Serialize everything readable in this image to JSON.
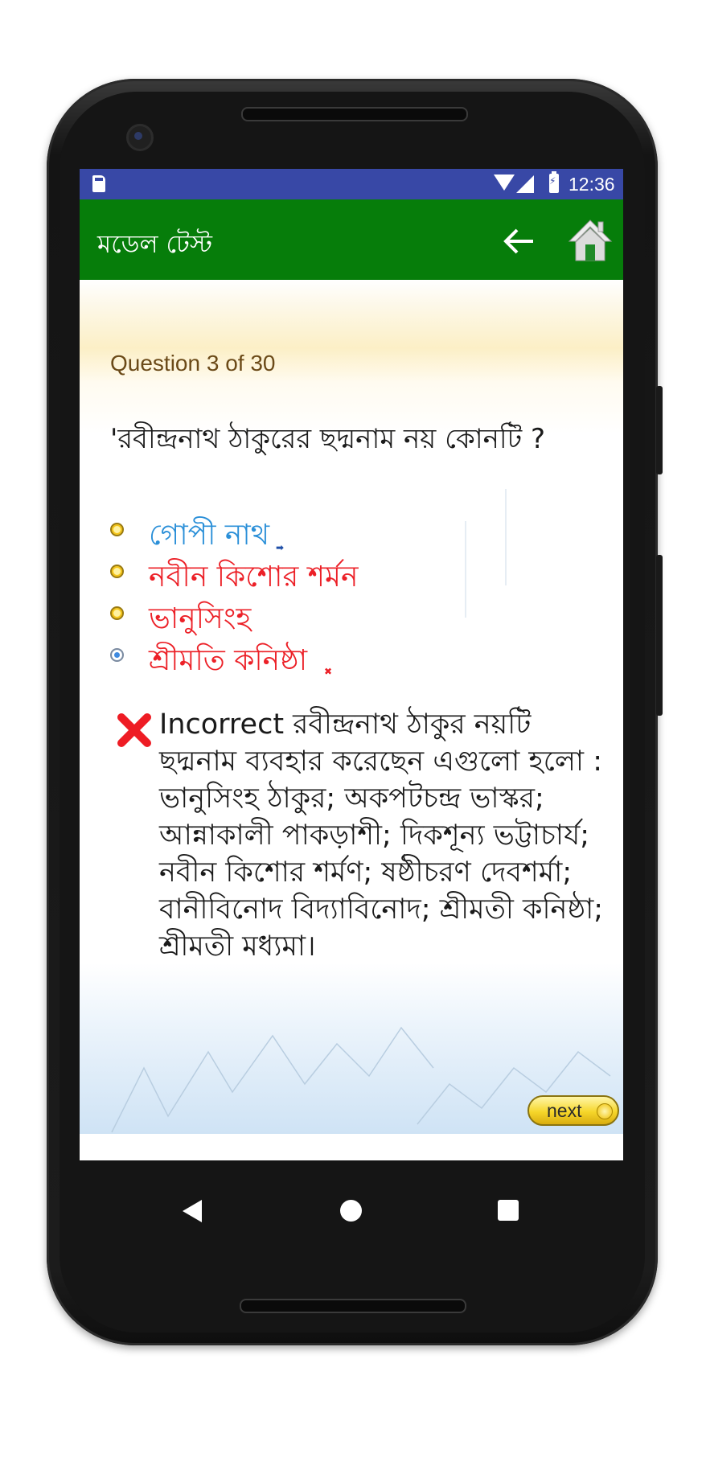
{
  "status_bar": {
    "time": "12:36"
  },
  "app_bar": {
    "title": "মডেল টেস্ট",
    "back_icon": "arrow-left-icon",
    "home_icon": "home-icon"
  },
  "quiz": {
    "counter": "Question 3 of 30",
    "question": "'রবীন্দ্রনাথ ঠাকুরের ছদ্মনাম নয় কোনটি ?",
    "options": [
      {
        "label": "গোপী নাথ",
        "color": "#2a8fd8",
        "selected": false,
        "marker": "correct-arrow"
      },
      {
        "label": "নবীন কিশোর শর্মন",
        "color": "#ec2027",
        "selected": false
      },
      {
        "label": "ভানুসিংহ",
        "color": "#ec2027",
        "selected": false
      },
      {
        "label": "শ্রীমতি কনিষ্ঠা",
        "color": "#ec2027",
        "selected": true,
        "marker": "wrong-x"
      }
    ],
    "feedback": {
      "status": "Incorrect",
      "icon": "red-x-icon",
      "text": "Incorrect রবীন্দ্রনাথ ঠাকুর নয়টি ছদ্মনাম ব্যবহার করেছেন এগুলো হলো : ভানুসিংহ ঠাকুর; অকপটচন্দ্র ভাস্কর; আন্নাকালী পাকড়াশী; দিকশূন্য ভট্টাচার্য; নবীন কিশোর শর্মণ; ষষ্ঠীচরণ দেবশর্মা; বানীবিনোদ বিদ্যাবিনোদ; শ্রীমতী কনিষ্ঠা; শ্রীমতী মধ্যমা।"
    },
    "next_label": "next"
  },
  "colors": {
    "status_bar": "#3848a6",
    "app_bar": "#067d0a",
    "correct": "#2a8fd8",
    "incorrect": "#ec2027"
  }
}
